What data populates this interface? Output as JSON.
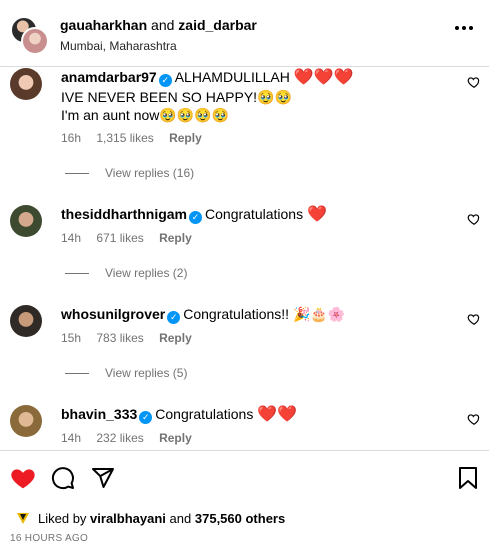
{
  "header": {
    "user1": "gauaharkhan",
    "and": "and",
    "user2": "zaid_darbar",
    "location": "Mumbai, Maharashtra",
    "more_icon": "more-horizontal-icon"
  },
  "comments": [
    {
      "username": "anamdarbar97",
      "text": "ALHAMDULILLAH",
      "hearts": "❤️❤️❤️",
      "line2": "IVE NEVER BEEN SO HAPPY!🥹🥹",
      "line3": "I'm an aunt now🥹🥹🥹🥹",
      "time": "16h",
      "likes": "1,315 likes",
      "reply": "Reply",
      "view_replies": "View replies (16)"
    },
    {
      "username": "thesiddharthnigam",
      "text": "Congratulations",
      "hearts": "❤️",
      "time": "14h",
      "likes": "671 likes",
      "reply": "Reply",
      "view_replies": "View replies (2)"
    },
    {
      "username": "whosunilgrover",
      "text": "Congratulations!!",
      "emojis": "🎉🎂🌸",
      "time": "15h",
      "likes": "783 likes",
      "reply": "Reply",
      "view_replies": "View replies (5)"
    },
    {
      "username": "bhavin_333",
      "text": "Congratulations",
      "hearts": "❤️❤️",
      "time": "14h",
      "likes": "232 likes",
      "reply": "Reply"
    }
  ],
  "footer": {
    "liked_by": "Liked by",
    "liker": "viralbhayani",
    "and": "and",
    "others": "375,560 others",
    "timestamp": "16 HOURS AGO",
    "colors": {
      "like": "#ed1c24",
      "verified": "#0095f6",
      "muted": "#737373"
    }
  }
}
